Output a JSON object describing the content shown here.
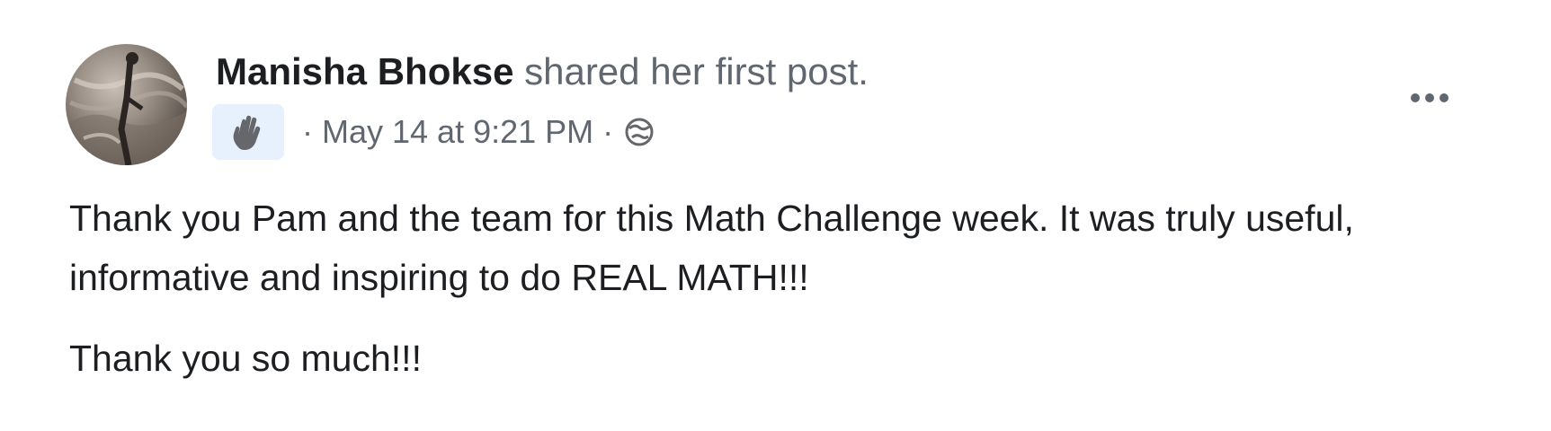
{
  "post": {
    "author_name": "Manisha Bhokse",
    "action_text": " shared her first post.",
    "separator": "·",
    "timestamp": "May 14 at 9:21 PM",
    "badge_icon": "waving-hand-icon",
    "audience_icon": "globe-icon",
    "more_icon": "more-options-icon",
    "paragraphs": [
      "Thank you Pam and the team for this Math Challenge week. It was truly useful, informative and inspiring to do REAL MATH!!!",
      "Thank you so much!!!"
    ]
  },
  "colors": {
    "text_primary": "#1c1e21",
    "text_secondary": "#606770",
    "badge_background": "#e7f0fd"
  }
}
